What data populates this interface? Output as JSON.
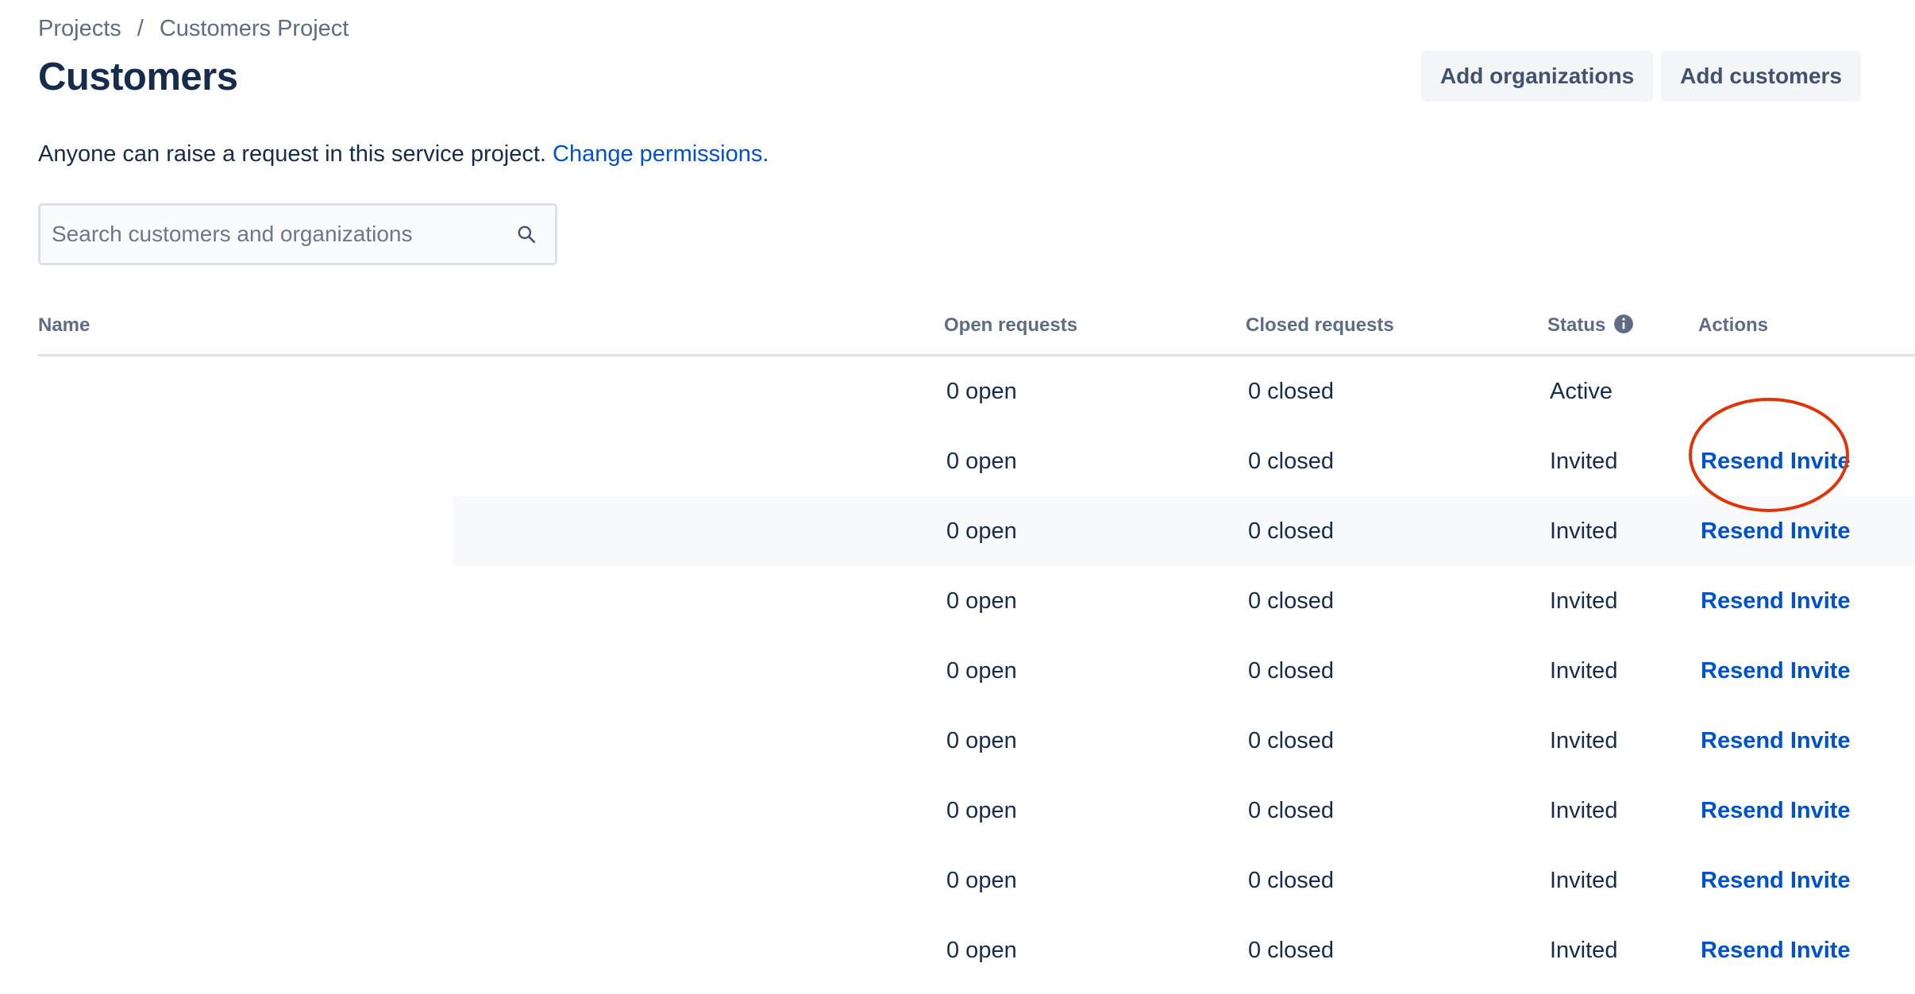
{
  "breadcrumb": {
    "items": [
      "Projects",
      "Customers Project"
    ],
    "separator": "/"
  },
  "page": {
    "title": "Customers"
  },
  "header_actions": {
    "add_organizations": "Add organizations",
    "add_customers": "Add customers"
  },
  "notice": {
    "text": "Anyone can raise a request in this service project.",
    "link": "Change permissions."
  },
  "search": {
    "placeholder": "Search customers and organizations",
    "value": ""
  },
  "table": {
    "columns": {
      "name": "Name",
      "open": "Open requests",
      "closed": "Closed requests",
      "status": "Status",
      "actions": "Actions"
    },
    "rows": [
      {
        "name": "",
        "open": "0 open",
        "closed": "0 closed",
        "status": "Active",
        "action": ""
      },
      {
        "name": "",
        "open": "0 open",
        "closed": "0 closed",
        "status": "Invited",
        "action": "Resend Invite"
      },
      {
        "name": "",
        "open": "0 open",
        "closed": "0 closed",
        "status": "Invited",
        "action": "Resend Invite"
      },
      {
        "name": "",
        "open": "0 open",
        "closed": "0 closed",
        "status": "Invited",
        "action": "Resend Invite"
      },
      {
        "name": "",
        "open": "0 open",
        "closed": "0 closed",
        "status": "Invited",
        "action": "Resend Invite"
      },
      {
        "name": "",
        "open": "0 open",
        "closed": "0 closed",
        "status": "Invited",
        "action": "Resend Invite"
      },
      {
        "name": "",
        "open": "0 open",
        "closed": "0 closed",
        "status": "Invited",
        "action": "Resend Invite"
      },
      {
        "name": "",
        "open": "0 open",
        "closed": "0 closed",
        "status": "Invited",
        "action": "Resend Invite"
      },
      {
        "name": "",
        "open": "0 open",
        "closed": "0 closed",
        "status": "Invited",
        "action": "Resend Invite"
      }
    ]
  },
  "icons": {
    "search": "search-icon",
    "status_info": "info-icon"
  },
  "colors": {
    "link": "#0052cc",
    "text_primary": "#172b4d",
    "text_subtle": "#5e6c84",
    "button_bg": "#f4f5f7",
    "annotation": "#de350b"
  }
}
